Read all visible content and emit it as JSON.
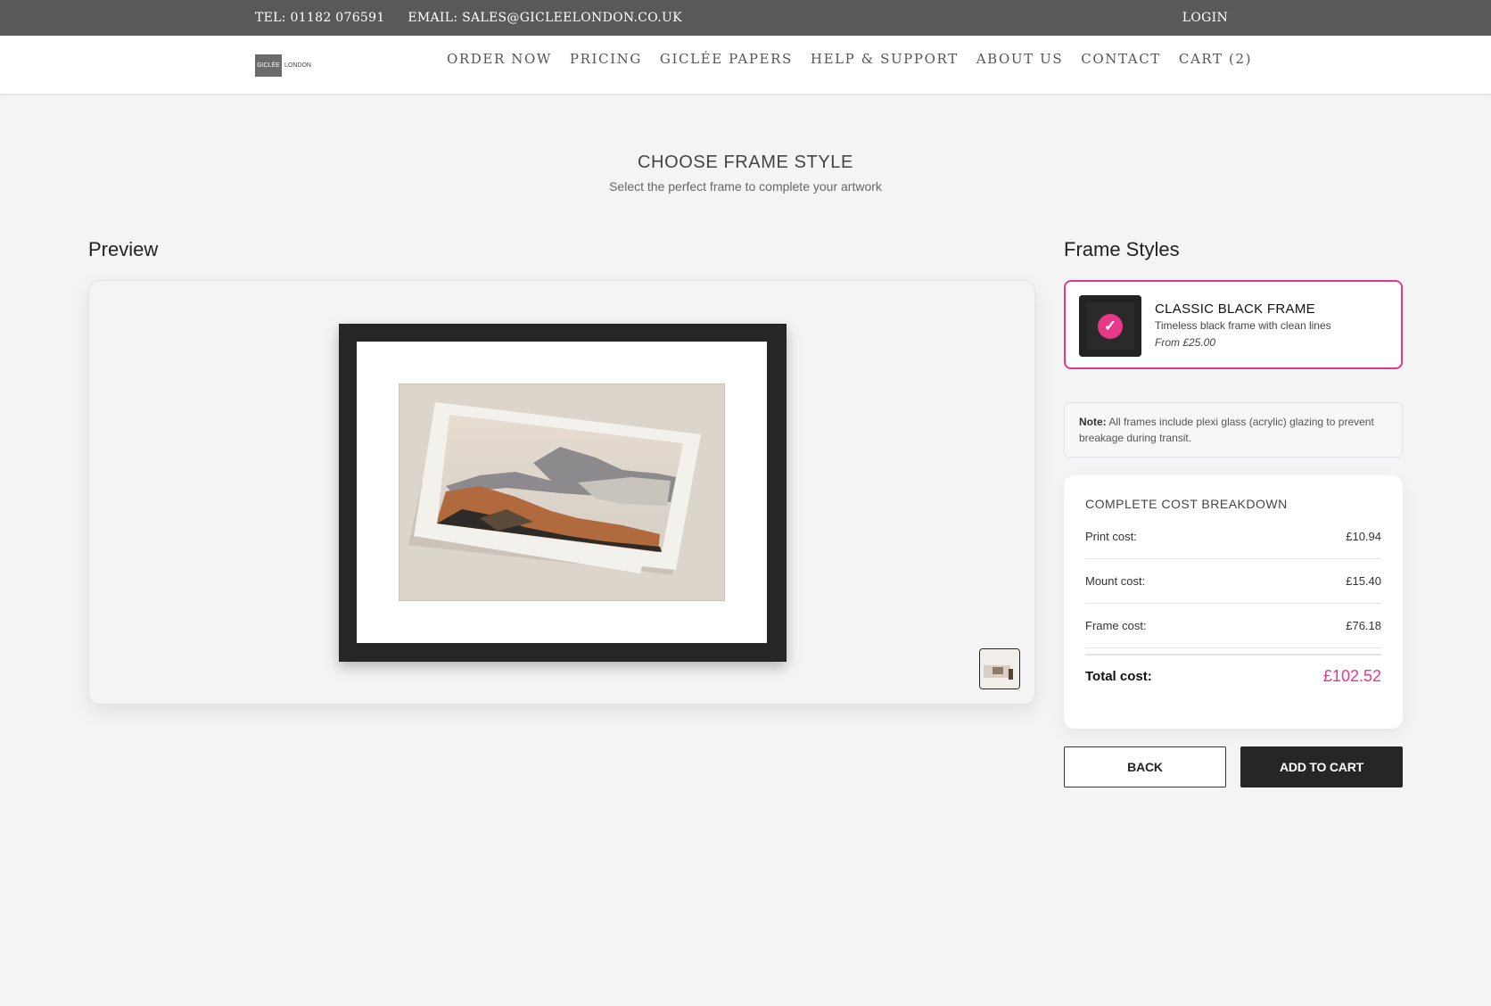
{
  "topbar": {
    "tel": "TEL: 01182 076591",
    "email": "EMAIL: SALES@GICLEELONDON.CO.UK",
    "login": "LOGIN"
  },
  "header": {
    "logo": {
      "mark": "GICLÉE",
      "text": "LONDON"
    },
    "nav": [
      "ORDER NOW",
      "PRICING",
      "GICLÉE PAPERS",
      "HELP & SUPPORT",
      "ABOUT US",
      "CONTACT",
      "CART (2)"
    ]
  },
  "page": {
    "title": "CHOOSE FRAME STYLE",
    "subtitle": "Select the perfect frame to complete your artwork"
  },
  "preview": {
    "heading": "Preview",
    "frame_color": "#262626",
    "mat_color": "#ffffff"
  },
  "frame_styles": {
    "heading": "Frame Styles",
    "selected": {
      "name": "CLASSIC BLACK FRAME",
      "description": "Timeless black frame with clean lines",
      "price": "From £25.00",
      "check": "✓"
    }
  },
  "note": {
    "label": "Note:",
    "text": "All frames include plexi glass (acrylic) glazing to prevent breakage during transit."
  },
  "cost": {
    "title": "COMPLETE COST BREAKDOWN",
    "rows": [
      {
        "label": "Print cost:",
        "value": "£10.94"
      },
      {
        "label": "Mount cost:",
        "value": "£15.40"
      },
      {
        "label": "Frame cost:",
        "value": "£76.18"
      }
    ],
    "total_label": "Total cost:",
    "total_value": "£102.52"
  },
  "actions": {
    "back": "BACK",
    "add_to_cart": "ADD TO CART"
  },
  "colors": {
    "accent": "#e8388a",
    "topbar": "#595959",
    "dark": "#262626"
  }
}
